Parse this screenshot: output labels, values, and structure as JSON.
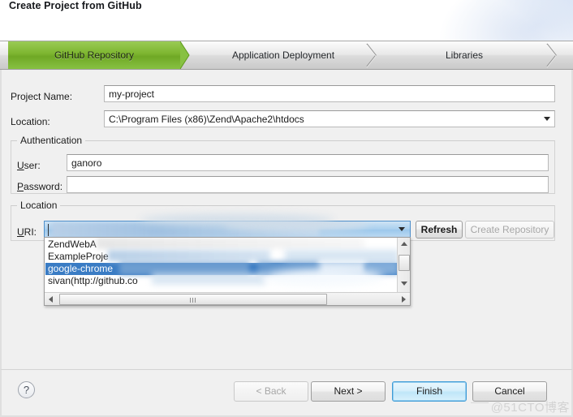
{
  "dialog": {
    "title": "Create Project from GitHub"
  },
  "steps": [
    {
      "label": "GitHub Repository",
      "state": "active"
    },
    {
      "label": "Application Deployment",
      "state": "inactive"
    },
    {
      "label": "Libraries",
      "state": "inactive"
    }
  ],
  "form": {
    "project_name": {
      "label": "Project Name:",
      "value": "my-project",
      "placeholder": ""
    },
    "location": {
      "label": "Location:",
      "value": "C:\\Program Files (x86)\\Zend\\Apache2\\htdocs",
      "placeholder": ""
    }
  },
  "authentication": {
    "group_title": "Authentication",
    "user": {
      "label_mnemonic": "U",
      "label_rest": "ser:",
      "value": "ganoro",
      "placeholder": ""
    },
    "password": {
      "label_mnemonic": "P",
      "label_rest": "assword:",
      "value": "",
      "placeholder": ""
    }
  },
  "location_group": {
    "group_title": "Location",
    "uri": {
      "label_mnemonic": "U",
      "label_rest": "RI:",
      "value": "",
      "placeholder": ""
    },
    "refresh_button": "Refresh",
    "create_repository_button": "Create Repository",
    "create_repository_enabled": false,
    "dropdown": {
      "open": true,
      "items": [
        {
          "label": "ZendWebA",
          "selected": false
        },
        {
          "label": "ExampleProje",
          "selected": false
        },
        {
          "label": "google-chrome",
          "selected": true
        },
        {
          "label": "sivan(http://github.co",
          "selected": false
        }
      ]
    }
  },
  "footer": {
    "help_button": "?",
    "back_button": "< Back",
    "back_enabled": false,
    "next_button": "Next >",
    "next_mnemonic": "N",
    "finish_button": "Finish",
    "finish_mnemonic": "F",
    "finish_default": true,
    "cancel_button": "Cancel"
  },
  "watermark": "@51CTO博客",
  "colors": {
    "step_active_green": "#7db52f",
    "selection_blue": "#3a7cc4",
    "default_button_blue": "#3c9bd6",
    "panel_bg": "#f0f0f0"
  }
}
